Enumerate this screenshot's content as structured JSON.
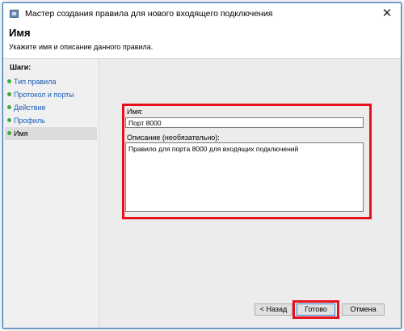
{
  "window": {
    "title": "Мастер создания правила для нового входящего подключения",
    "close_glyph": "✕"
  },
  "header": {
    "title": "Имя",
    "description": "Укажите имя и описание данного правила."
  },
  "steps": {
    "header": "Шаги:",
    "items": [
      {
        "label": "Тип правила"
      },
      {
        "label": "Протокол и порты"
      },
      {
        "label": "Действие"
      },
      {
        "label": "Профиль"
      },
      {
        "label": "Имя"
      }
    ],
    "active_index": 4
  },
  "form": {
    "name_label": "Имя:",
    "name_value": "Порт 8000",
    "description_label": "Описание (необязательно):",
    "description_value": "Правило для порта 8000 для входящих подключений"
  },
  "buttons": {
    "back": "< Назад",
    "finish": "Готово",
    "cancel": "Отмена"
  },
  "colors": {
    "highlight": "#e8101a",
    "step_link": "#1a5bb8",
    "step_dot": "#3faa3f"
  },
  "icons": {
    "app": "firewall-wizard-icon",
    "close": "close-icon",
    "step_bullet": "green-dot-icon"
  }
}
